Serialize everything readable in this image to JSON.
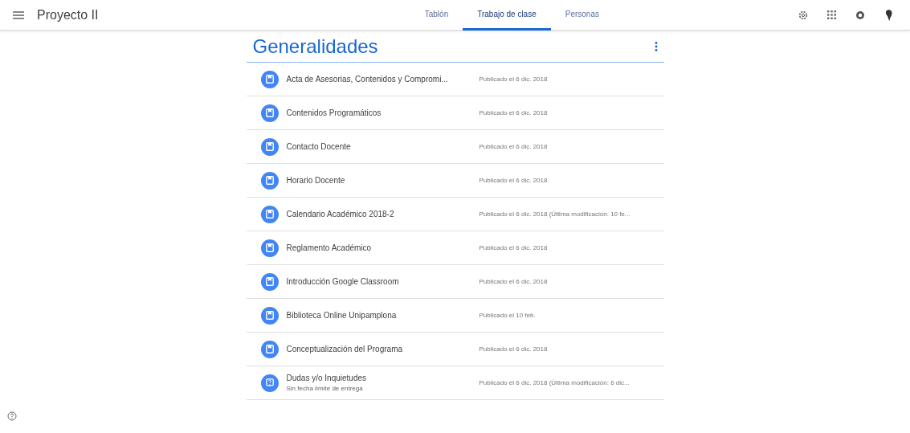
{
  "app_bar": {
    "title": "Proyecto II"
  },
  "tabs": [
    {
      "label": "Tablón",
      "selected": false
    },
    {
      "label": "Trabajo de clase",
      "selected": true
    },
    {
      "label": "Personas",
      "selected": false
    }
  ],
  "topic": {
    "title": "Generalidades"
  },
  "items": [
    {
      "kind": "material",
      "title": "Acta de Asesorias, Contenidos y Compromi...",
      "published": "Publicado el 6 dic. 2018"
    },
    {
      "kind": "material",
      "title": "Contenidos Programáticos",
      "published": "Publicado el 6 dic. 2018"
    },
    {
      "kind": "material",
      "title": "Contacto Docente",
      "published": "Publicado el 6 dic. 2018"
    },
    {
      "kind": "material",
      "title": "Horario Docente",
      "published": "Publicado el 6 dic. 2018"
    },
    {
      "kind": "material",
      "title": "Calendario Académico 2018-2",
      "published": "Publicado el 6 dic. 2018 (Última modificación: 10 fe..."
    },
    {
      "kind": "material",
      "title": "Reglamento Académico",
      "published": "Publicado el 6 dic. 2018"
    },
    {
      "kind": "material",
      "title": "Introducción Google Classroom",
      "published": "Publicado el 6 dic. 2018"
    },
    {
      "kind": "material",
      "title": "Biblioteca Online Unipamplona",
      "published": "Publicado el 10 feb."
    },
    {
      "kind": "material",
      "title": "Conceptualización del Programa",
      "published": "Publicado el 6 dic. 2018"
    },
    {
      "kind": "question",
      "title": "Dudas y/o Inquietudes",
      "subtitle": "Sin fecha límite de entrega",
      "published": "Publicado el 6 dic. 2018 (Última modificación: 6 dic..."
    }
  ]
}
